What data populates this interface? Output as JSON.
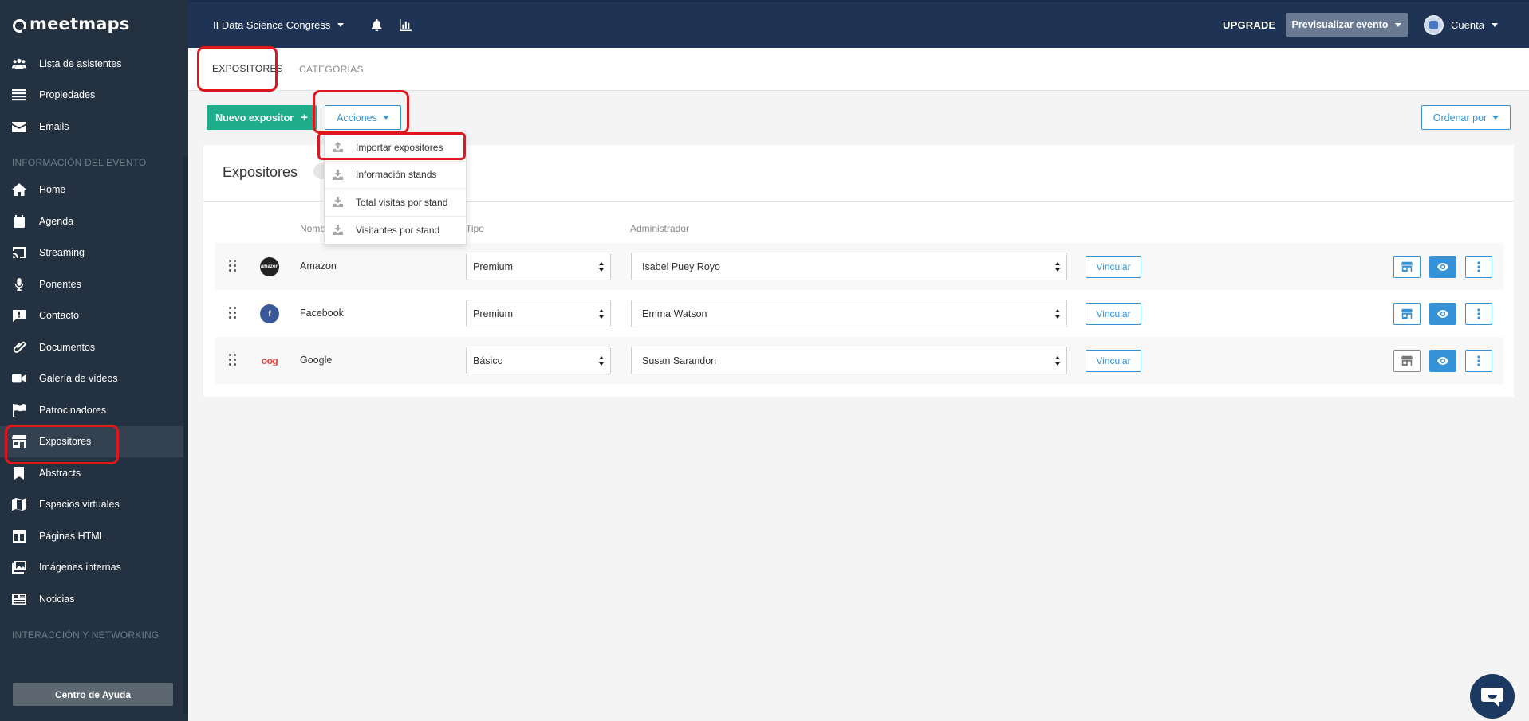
{
  "brand": {
    "name": "meetmaps"
  },
  "sidebar": {
    "items_top": [
      {
        "label": "Lista de asistentes",
        "icon": "users-icon"
      },
      {
        "label": "Propiedades",
        "icon": "list-icon"
      },
      {
        "label": "Emails",
        "icon": "envelope-icon"
      }
    ],
    "section_info": "INFORMACIÓN DEL EVENTO",
    "items_info": [
      {
        "label": "Home",
        "icon": "home-icon"
      },
      {
        "label": "Agenda",
        "icon": "calendar-icon"
      },
      {
        "label": "Streaming",
        "icon": "cast-icon"
      },
      {
        "label": "Ponentes",
        "icon": "microphone-icon"
      },
      {
        "label": "Contacto",
        "icon": "chat-alert-icon"
      },
      {
        "label": "Documentos",
        "icon": "paperclip-icon"
      },
      {
        "label": "Galería de vídeos",
        "icon": "video-icon"
      },
      {
        "label": "Patrocinadores",
        "icon": "flag-icon"
      },
      {
        "label": "Expositores",
        "icon": "store-icon",
        "active": true
      },
      {
        "label": "Abstracts",
        "icon": "bookmark-icon"
      },
      {
        "label": "Espacios virtuales",
        "icon": "map-icon"
      },
      {
        "label": "Páginas HTML",
        "icon": "layout-icon"
      },
      {
        "label": "Imágenes internas",
        "icon": "images-icon"
      },
      {
        "label": "Noticias",
        "icon": "newspaper-icon"
      }
    ],
    "section_networking": "INTERACCIÓN Y NETWORKING",
    "help_button": "Centro de Ayuda"
  },
  "topbar": {
    "event_name": "II Data Science Congress",
    "upgrade": "UPGRADE",
    "preview_button": "Previsualizar evento",
    "account": "Cuenta"
  },
  "tabs": [
    {
      "label": "EXPOSITORES",
      "active": true
    },
    {
      "label": "CATEGORÍAS",
      "active": false
    }
  ],
  "actions": {
    "new_button": "Nuevo expositor",
    "new_button_icon": "+",
    "actions_button": "Acciones",
    "sort_button": "Ordenar por",
    "menu": [
      "Importar expositores",
      "Información stands",
      "Total visitas por stand",
      "Visitantes por stand"
    ]
  },
  "table": {
    "title": "Expositores",
    "headers": {
      "name": "Nomb",
      "type": "Tipo",
      "admin": "Administrador"
    },
    "link_button": "Vincular",
    "rows": [
      {
        "name": "Amazon",
        "type": "Premium",
        "admin": "Isabel Puey Royo",
        "logo_text": "amazon"
      },
      {
        "name": "Facebook",
        "type": "Premium",
        "admin": "Emma Watson",
        "logo_text": "f"
      },
      {
        "name": "Google",
        "type": "Básico",
        "admin": "Susan Sarandon",
        "logo_text": "oog"
      }
    ]
  },
  "colors": {
    "sidebar_bg": "#233140",
    "topbar_bg": "#1f3354",
    "primary_green": "#1fae8b",
    "accent_blue": "#3693d8",
    "annotation_red": "#e0161f"
  }
}
